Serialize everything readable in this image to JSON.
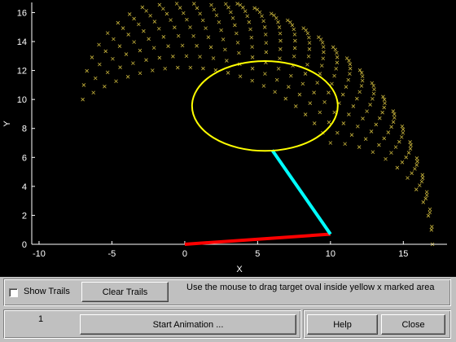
{
  "plot": {
    "xlabel": "X",
    "ylabel": "Y",
    "xticks": [
      "-10",
      "-5",
      "0",
      "5",
      "10",
      "15"
    ],
    "yticks": [
      "0",
      "2",
      "4",
      "6",
      "8",
      "10",
      "12",
      "14",
      "16"
    ],
    "xlim": [
      -10.5,
      18
    ],
    "ylim": [
      0,
      16.7
    ],
    "target_oval": {
      "cx": 5.5,
      "cy": 9.55,
      "rx": 5.0,
      "ry": 3.1
    },
    "arm": {
      "base": [
        0,
        0
      ],
      "elbow": [
        10,
        0.7
      ],
      "end": [
        6,
        6.5
      ]
    },
    "colors": {
      "trails": "#c8b43c",
      "oval": "#ffff00",
      "link1": "#ff0000",
      "link2": "#00ffff",
      "axes": "#ffffff",
      "background": "#000000"
    }
  },
  "controls": {
    "show_trails_label": "Show Trails",
    "show_trails_checked": false,
    "clear_trails_label": "Clear Trails",
    "instruction": "Use the mouse to drag target oval inside yellow x marked area",
    "counter": "1",
    "start_animation_label": "Start Animation ...",
    "help_label": "Help",
    "close_label": "Close"
  }
}
